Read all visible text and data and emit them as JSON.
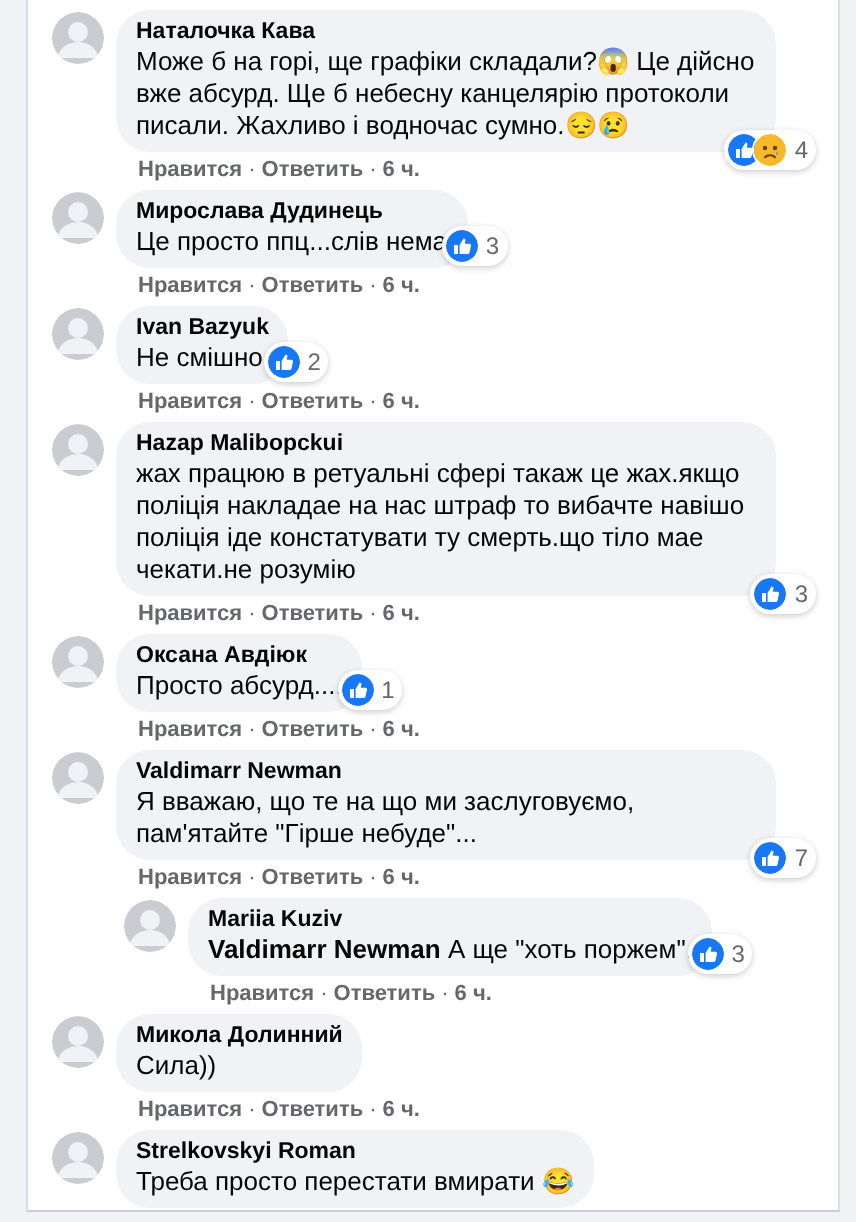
{
  "comments": [
    {
      "author": "Наталочка Кава",
      "text": "Може б на горі, ще графіки складали?😱 Це дійсно вже абсурд. Ще б небесну канцелярію протоколи писали. Жахливо і водночас сумно.😔😢",
      "reactions": {
        "like": true,
        "sad": true,
        "count": "4"
      },
      "actions": [
        {
          "kind": "link",
          "text": "Нравится"
        },
        {
          "kind": "dot",
          "text": "·"
        },
        {
          "kind": "link",
          "text": "Ответить"
        },
        {
          "kind": "dot",
          "text": "·"
        },
        {
          "kind": "time",
          "text": "6 ч."
        }
      ]
    },
    {
      "author": "Мирослава Дудинець",
      "text": "Це просто ппц...слів нема",
      "reactions": {
        "like": true,
        "sad": false,
        "count": "3"
      },
      "actions": [
        {
          "kind": "link",
          "text": "Нравится"
        },
        {
          "kind": "dot",
          "text": "·"
        },
        {
          "kind": "link",
          "text": "Ответить"
        },
        {
          "kind": "dot",
          "text": "·"
        },
        {
          "kind": "time",
          "text": "6 ч."
        }
      ]
    },
    {
      "author": "Ivan Bazyuk",
      "text": "Не смішно",
      "reactions": {
        "like": true,
        "sad": false,
        "count": "2"
      },
      "actions": [
        {
          "kind": "link",
          "text": "Нравится"
        },
        {
          "kind": "dot",
          "text": "·"
        },
        {
          "kind": "link",
          "text": "Ответить"
        },
        {
          "kind": "dot",
          "text": "·"
        },
        {
          "kind": "time",
          "text": "6 ч."
        }
      ]
    },
    {
      "author": "Hazap Malibopckui",
      "text": "жах працюю в ретуальні сфері такаж це жах.якщо поліція накладае на нас штраф то вибачте навішо поліція іде констатувати ту смерть.що тіло мае чекати.не розумію",
      "reactions": {
        "like": true,
        "sad": false,
        "count": "3"
      },
      "actions": [
        {
          "kind": "link",
          "text": "Нравится"
        },
        {
          "kind": "dot",
          "text": "·"
        },
        {
          "kind": "link",
          "text": "Ответить"
        },
        {
          "kind": "dot",
          "text": "·"
        },
        {
          "kind": "time",
          "text": "6 ч."
        }
      ]
    },
    {
      "author": "Оксана Авдіюк",
      "text": "Просто абсурд....",
      "reactions": {
        "like": true,
        "sad": false,
        "count": "1"
      },
      "actions": [
        {
          "kind": "link",
          "text": "Нравится"
        },
        {
          "kind": "dot",
          "text": "·"
        },
        {
          "kind": "link",
          "text": "Ответить"
        },
        {
          "kind": "dot",
          "text": "·"
        },
        {
          "kind": "time",
          "text": "6 ч."
        }
      ]
    },
    {
      "author": "Valdimarr Newman",
      "text": "Я вважаю, що те на що ми заслуговуємо, пам'ятайте \"Гірше небуде\"...",
      "reactions": {
        "like": true,
        "sad": false,
        "count": "7"
      },
      "actions": [
        {
          "kind": "link",
          "text": "Нравится"
        },
        {
          "kind": "dot",
          "text": "·"
        },
        {
          "kind": "link",
          "text": "Ответить"
        },
        {
          "kind": "dot",
          "text": "·"
        },
        {
          "kind": "time",
          "text": "6 ч."
        }
      ],
      "replies": [
        {
          "author": "Mariia Kuziv",
          "text": "**Valdimarr Newman** А ще \"хоть поржем\".",
          "reactions": {
            "like": true,
            "sad": false,
            "count": "3"
          },
          "actions": [
            {
              "kind": "link",
              "text": "Нравится"
            },
            {
              "kind": "dot",
              "text": "·"
            },
            {
              "kind": "link",
              "text": "Ответить"
            },
            {
              "kind": "dot",
              "text": "·"
            },
            {
              "kind": "time",
              "text": "6 ч."
            }
          ]
        }
      ]
    },
    {
      "author": "Микола Долинний",
      "text": "Сила))",
      "actions": [
        {
          "kind": "link",
          "text": "Нравится"
        },
        {
          "kind": "dot",
          "text": "·"
        },
        {
          "kind": "link",
          "text": "Ответить"
        },
        {
          "kind": "dot",
          "text": "·"
        },
        {
          "kind": "time",
          "text": "6 ч."
        }
      ]
    },
    {
      "author": "Strelkovskyi Roman",
      "text": "Треба просто перестати вмирати 😂"
    }
  ]
}
